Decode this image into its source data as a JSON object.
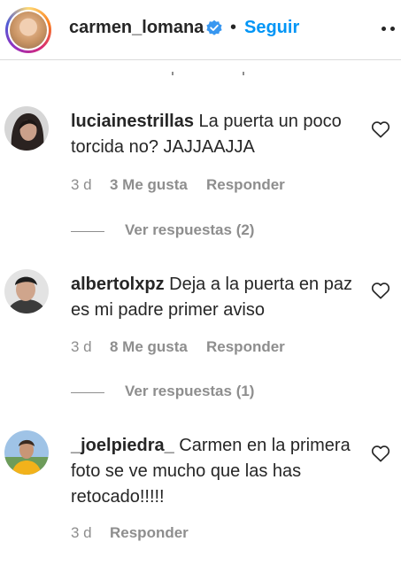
{
  "header": {
    "username": "carmen_lomana",
    "separator": "•",
    "follow_label": "Seguir"
  },
  "comments": [
    {
      "user": "luciainestrillas",
      "text": "La puerta un poco torcida no? JAJJAAJJA",
      "time": "3 d",
      "likes": "3 Me gusta",
      "reply_label": "Responder",
      "view_replies": "Ver respuestas (2)"
    },
    {
      "user": "albertolxpz",
      "text": "Deja a la puerta en paz es mi padre primer aviso",
      "time": "3 d",
      "likes": "8 Me gusta",
      "reply_label": "Responder",
      "view_replies": "Ver respuestas (1)"
    },
    {
      "user": "_joelpiedra_",
      "text": "Carmen en la primera foto se ve mucho que las has retocado!!!!!",
      "time": "3 d",
      "reply_label": "Responder"
    }
  ],
  "icons": {
    "verified": "verified-badge-icon",
    "more": "more-options-icon",
    "like": "heart-outline-icon"
  },
  "colors": {
    "accent": "#0095f6",
    "text": "#262626",
    "secondary": "#8e8e8e",
    "divider": "#dbdbdb"
  }
}
